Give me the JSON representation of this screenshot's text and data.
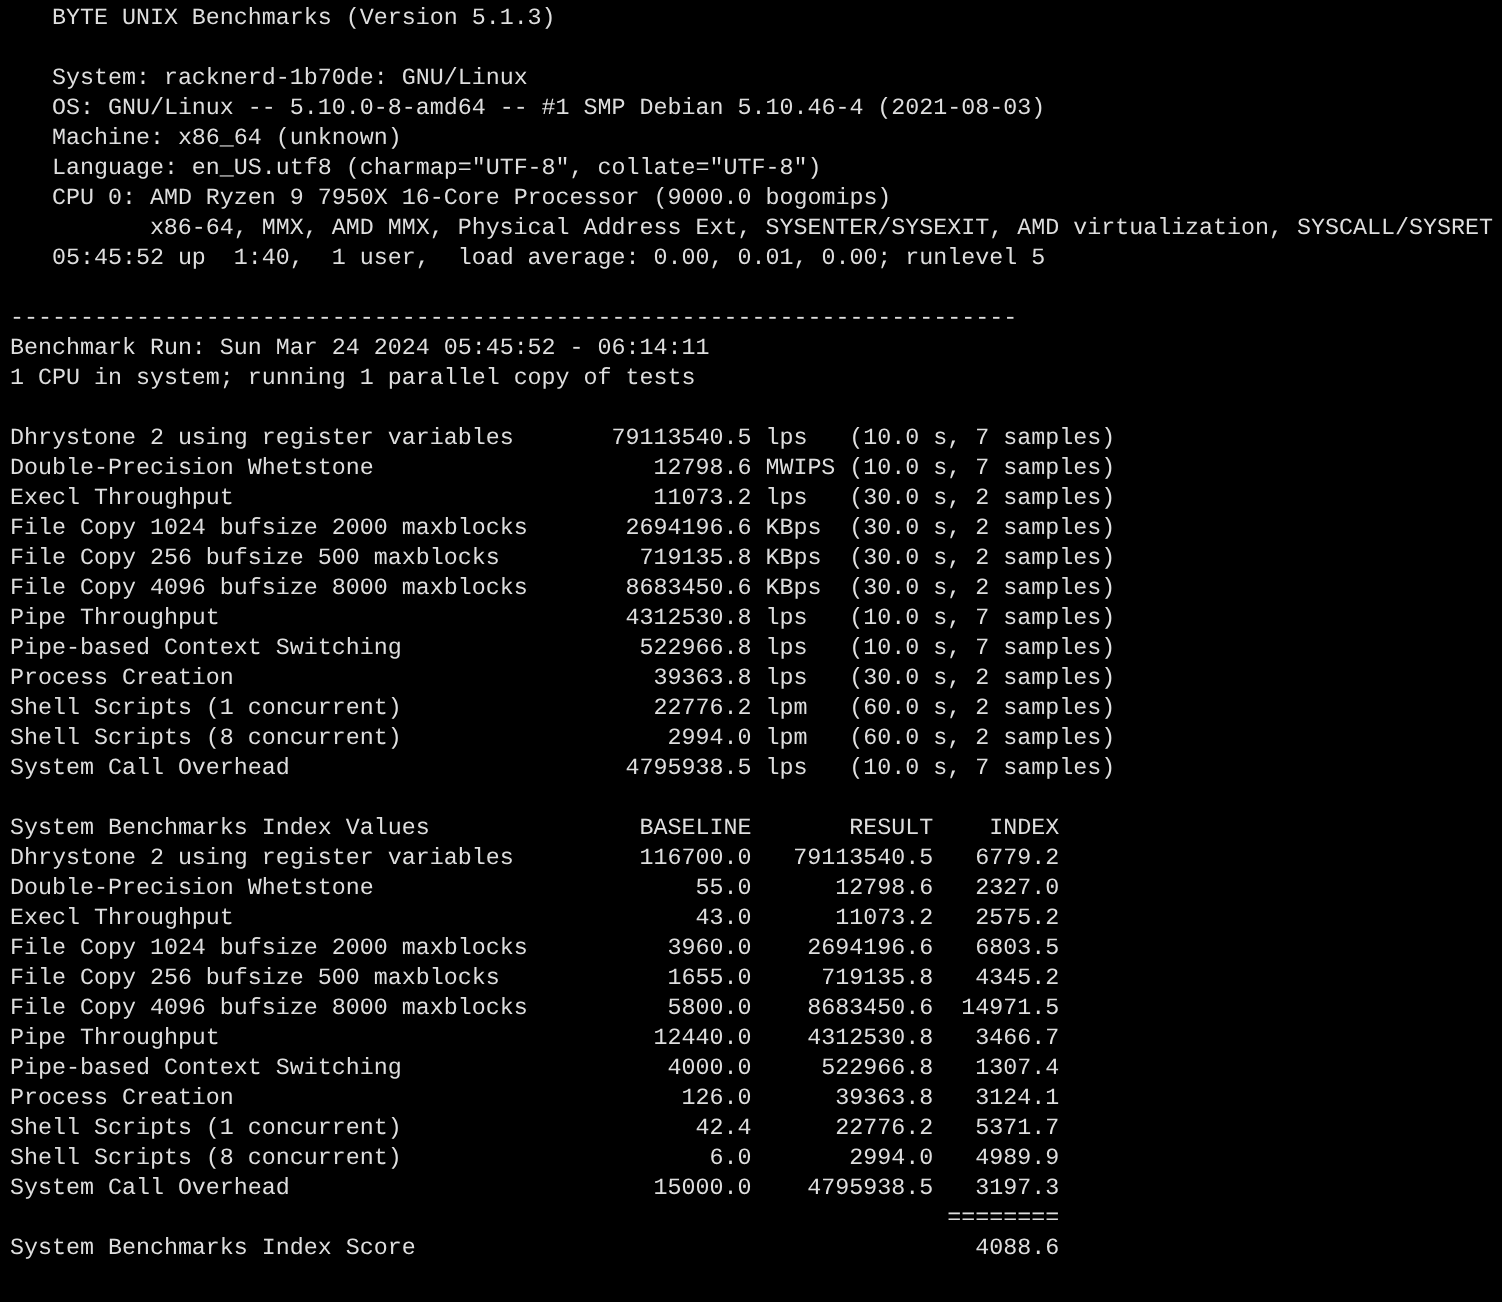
{
  "title": "BYTE UNIX Benchmarks (Version 5.1.3)",
  "system_info": [
    {
      "text": "System: racknerd-1b70de: GNU/Linux",
      "continuation": false
    },
    {
      "text": "OS: GNU/Linux -- 5.10.0-8-amd64 -- #1 SMP Debian 5.10.46-4 (2021-08-03)",
      "continuation": false
    },
    {
      "text": "Machine: x86_64 (unknown)",
      "continuation": false
    },
    {
      "text": "Language: en_US.utf8 (charmap=\"UTF-8\", collate=\"UTF-8\")",
      "continuation": false
    },
    {
      "text": "CPU 0: AMD Ryzen 9 7950X 16-Core Processor (9000.0 bogomips)",
      "continuation": false
    },
    {
      "text": "x86-64, MMX, AMD MMX, Physical Address Ext, SYSENTER/SYSEXIT, AMD virtualization, SYSCALL/SYSRET",
      "continuation": true
    },
    {
      "text": "05:45:52 up  1:40,  1 user,  load average: 0.00, 0.01, 0.00; runlevel 5",
      "continuation": false
    }
  ],
  "run": {
    "separator": "------------------------------------------------------------------------",
    "lines": [
      "Benchmark Run: Sun Mar 24 2024 05:45:52 - 06:14:11",
      "1 CPU in system; running 1 parallel copy of tests"
    ]
  },
  "results": [
    {
      "test": "Dhrystone 2 using register variables",
      "value": "79113540.5",
      "unit": "lps",
      "timing": "(10.0 s, 7 samples)"
    },
    {
      "test": "Double-Precision Whetstone",
      "value": "12798.6",
      "unit": "MWIPS",
      "timing": "(10.0 s, 7 samples)"
    },
    {
      "test": "Execl Throughput",
      "value": "11073.2",
      "unit": "lps",
      "timing": "(30.0 s, 2 samples)"
    },
    {
      "test": "File Copy 1024 bufsize 2000 maxblocks",
      "value": "2694196.6",
      "unit": "KBps",
      "timing": "(30.0 s, 2 samples)"
    },
    {
      "test": "File Copy 256 bufsize 500 maxblocks",
      "value": "719135.8",
      "unit": "KBps",
      "timing": "(30.0 s, 2 samples)"
    },
    {
      "test": "File Copy 4096 bufsize 8000 maxblocks",
      "value": "8683450.6",
      "unit": "KBps",
      "timing": "(30.0 s, 2 samples)"
    },
    {
      "test": "Pipe Throughput",
      "value": "4312530.8",
      "unit": "lps",
      "timing": "(10.0 s, 7 samples)"
    },
    {
      "test": "Pipe-based Context Switching",
      "value": "522966.8",
      "unit": "lps",
      "timing": "(10.0 s, 7 samples)"
    },
    {
      "test": "Process Creation",
      "value": "39363.8",
      "unit": "lps",
      "timing": "(30.0 s, 2 samples)"
    },
    {
      "test": "Shell Scripts (1 concurrent)",
      "value": "22776.2",
      "unit": "lpm",
      "timing": "(60.0 s, 2 samples)"
    },
    {
      "test": "Shell Scripts (8 concurrent)",
      "value": "2994.0",
      "unit": "lpm",
      "timing": "(60.0 s, 2 samples)"
    },
    {
      "test": "System Call Overhead",
      "value": "4795938.5",
      "unit": "lps",
      "timing": "(10.0 s, 7 samples)"
    }
  ],
  "index": {
    "columns": [
      "System Benchmarks Index Values",
      "BASELINE",
      "RESULT",
      "INDEX"
    ],
    "rows": [
      {
        "test": "Dhrystone 2 using register variables",
        "baseline": "116700.0",
        "result": "79113540.5",
        "index": "6779.2"
      },
      {
        "test": "Double-Precision Whetstone",
        "baseline": "55.0",
        "result": "12798.6",
        "index": "2327.0"
      },
      {
        "test": "Execl Throughput",
        "baseline": "43.0",
        "result": "11073.2",
        "index": "2575.2"
      },
      {
        "test": "File Copy 1024 bufsize 2000 maxblocks",
        "baseline": "3960.0",
        "result": "2694196.6",
        "index": "6803.5"
      },
      {
        "test": "File Copy 256 bufsize 500 maxblocks",
        "baseline": "1655.0",
        "result": "719135.8",
        "index": "4345.2"
      },
      {
        "test": "File Copy 4096 bufsize 8000 maxblocks",
        "baseline": "5800.0",
        "result": "8683450.6",
        "index": "14971.5"
      },
      {
        "test": "Pipe Throughput",
        "baseline": "12440.0",
        "result": "4312530.8",
        "index": "3466.7"
      },
      {
        "test": "Pipe-based Context Switching",
        "baseline": "4000.0",
        "result": "522966.8",
        "index": "1307.4"
      },
      {
        "test": "Process Creation",
        "baseline": "126.0",
        "result": "39363.8",
        "index": "3124.1"
      },
      {
        "test": "Shell Scripts (1 concurrent)",
        "baseline": "42.4",
        "result": "22776.2",
        "index": "5371.7"
      },
      {
        "test": "Shell Scripts (8 concurrent)",
        "baseline": "6.0",
        "result": "2994.0",
        "index": "4989.9"
      },
      {
        "test": "System Call Overhead",
        "baseline": "15000.0",
        "result": "4795938.5",
        "index": "3197.3"
      }
    ],
    "separator": "========",
    "score_label": "System Benchmarks Index Score",
    "score": "4088.6"
  }
}
